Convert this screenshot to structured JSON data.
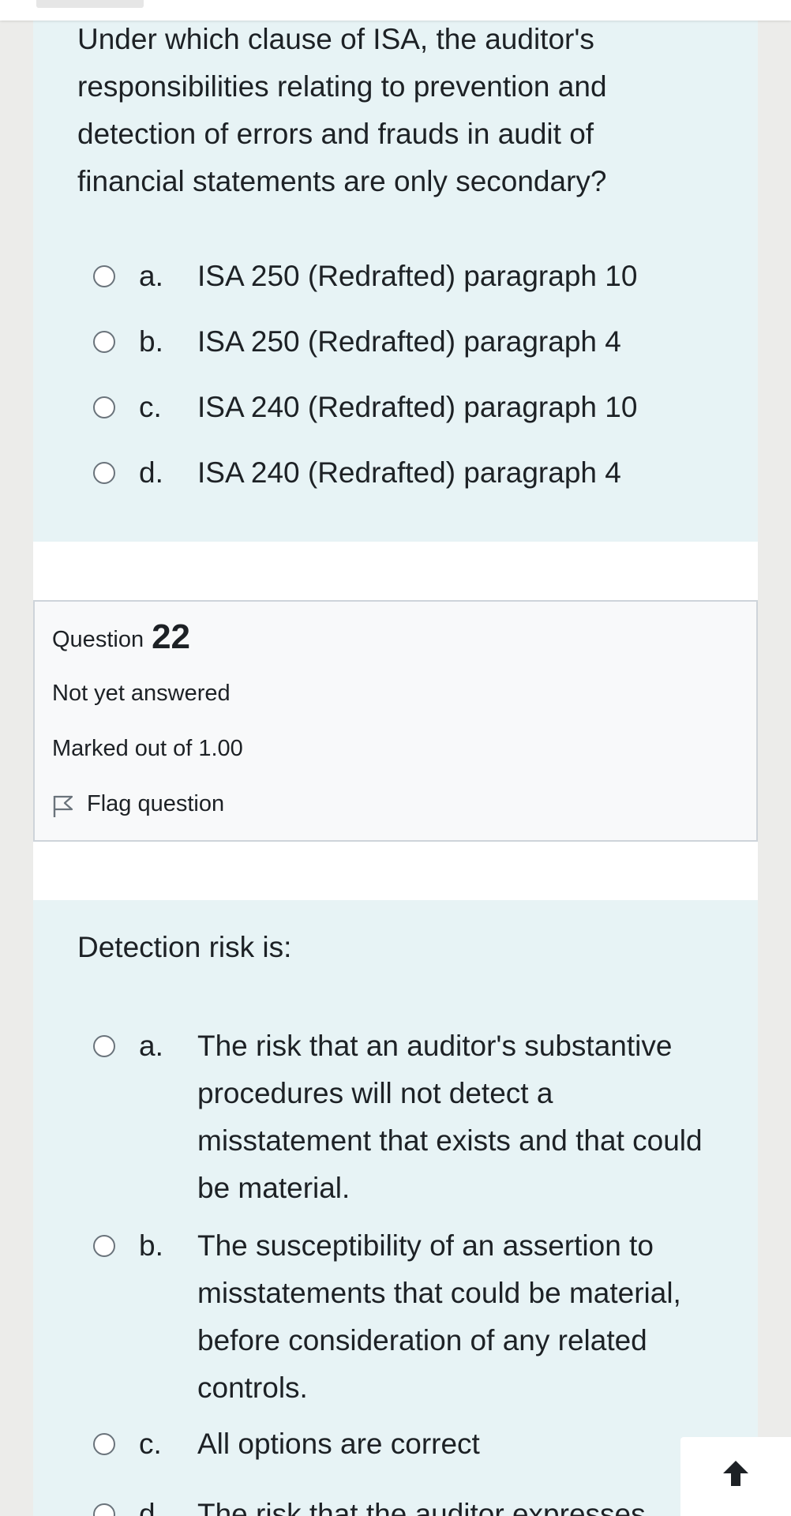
{
  "question_21": {
    "text": "Under which clause of ISA, the auditor's responsibilities relating to prevention and detection of errors and frauds in audit of financial statements are only secondary?",
    "options": [
      {
        "letter": "a.",
        "text": "ISA 250 (Redrafted) paragraph 10"
      },
      {
        "letter": "b.",
        "text": "ISA 250 (Redrafted) paragraph 4"
      },
      {
        "letter": "c.",
        "text": "ISA 240 (Redrafted) paragraph 10"
      },
      {
        "letter": "d.",
        "text": "ISA 240 (Redrafted) paragraph 4"
      }
    ]
  },
  "question_22": {
    "label": "Question",
    "number": "22",
    "status": "Not yet answered",
    "marks": "Marked out of 1.00",
    "flag_label": "Flag question",
    "text": "Detection risk is:",
    "options": [
      {
        "letter": "a.",
        "text": "The risk that an auditor's substantive procedures will not detect a misstatement that exists and that could be material."
      },
      {
        "letter": "b.",
        "text": "The susceptibility of an assertion to misstatements that could be material, before consideration of any related controls."
      },
      {
        "letter": "c.",
        "text": "All options are correct"
      },
      {
        "letter": "d.",
        "text": "The risk that the auditor expresses"
      }
    ]
  },
  "icons": {
    "radio": "radio-unchecked-icon",
    "flag": "flag-outline-icon",
    "back_to_top": "arrow-up-icon"
  },
  "colors": {
    "formulation_bg": "#e7f3f5",
    "info_bg": "#f8f9fa",
    "info_border": "#ced4da",
    "text": "#1d2125"
  }
}
